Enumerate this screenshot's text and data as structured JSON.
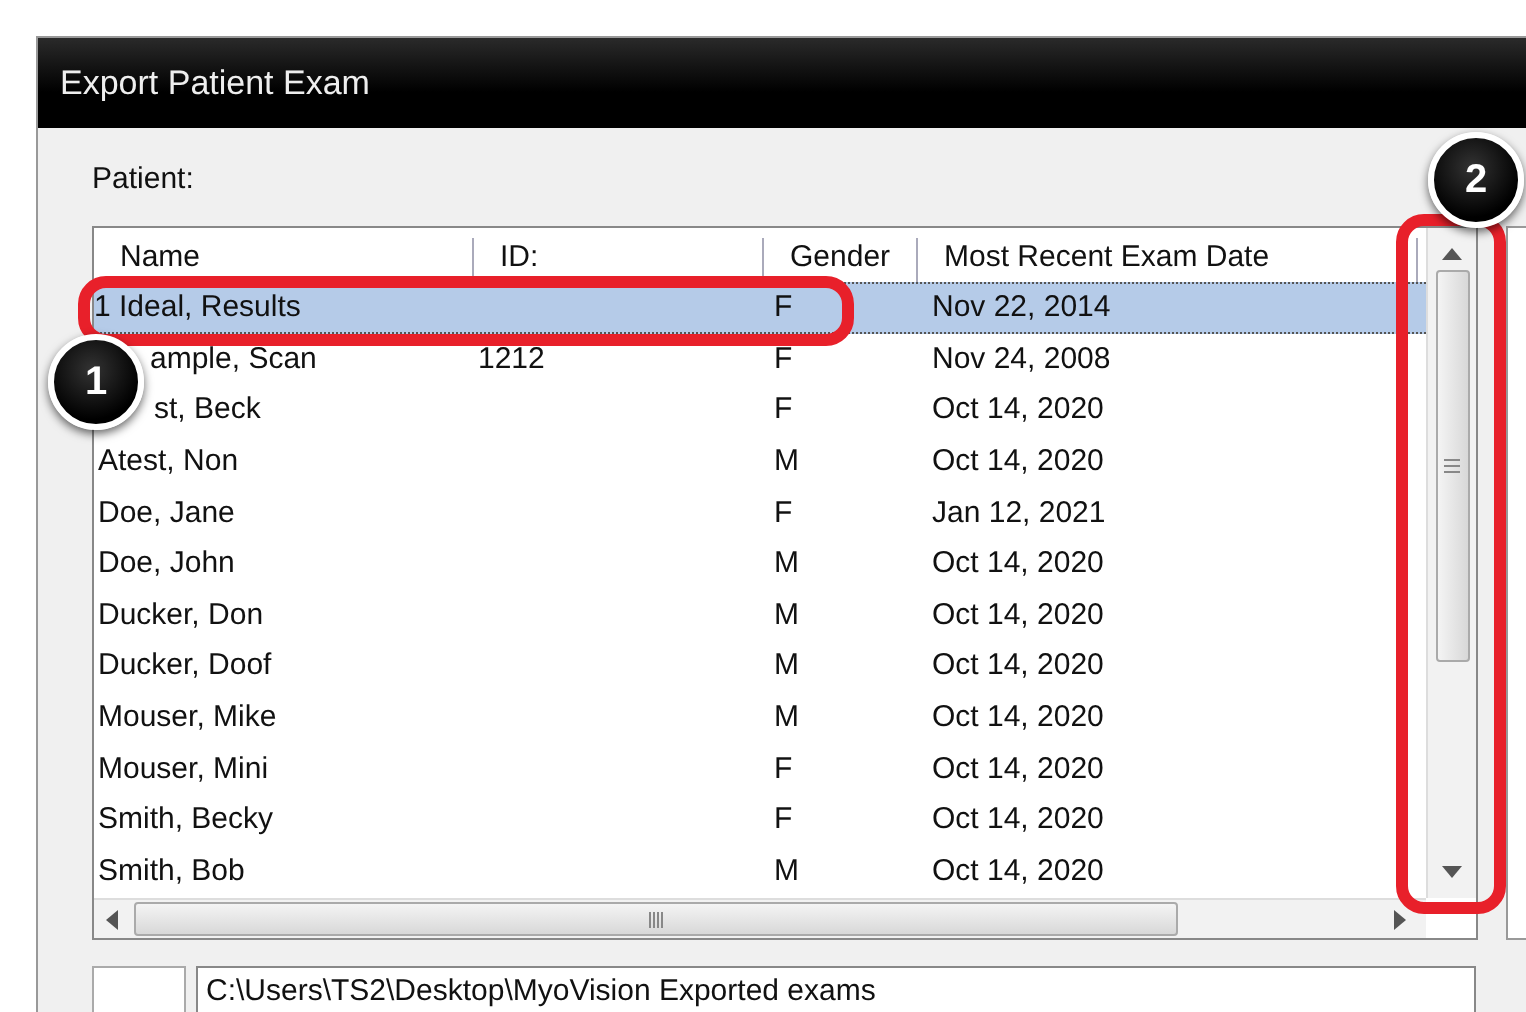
{
  "window": {
    "title": "Export Patient Exam"
  },
  "patient_label": "Patient:",
  "table": {
    "columns": [
      "Name",
      "ID:",
      "Gender",
      "Most Recent Exam Date"
    ],
    "rows": [
      {
        "cells": [
          "1 Ideal, Results",
          "",
          "F",
          "Nov 22, 2014"
        ],
        "selected": true
      },
      {
        "cells": [
          "ample, Scan",
          "1212",
          "F",
          "Nov 24, 2008"
        ],
        "selected": false
      },
      {
        "cells": [
          "st, Beck",
          "",
          "F",
          "Oct 14, 2020"
        ],
        "selected": false
      },
      {
        "cells": [
          "Atest, Non",
          "",
          "M",
          "Oct 14, 2020"
        ],
        "selected": false
      },
      {
        "cells": [
          "Doe, Jane",
          "",
          "F",
          "Jan 12, 2021"
        ],
        "selected": false
      },
      {
        "cells": [
          "Doe, John",
          "",
          "M",
          "Oct 14, 2020"
        ],
        "selected": false
      },
      {
        "cells": [
          "Ducker, Don",
          "",
          "M",
          "Oct 14, 2020"
        ],
        "selected": false
      },
      {
        "cells": [
          "Ducker, Doof",
          "",
          "M",
          "Oct 14, 2020"
        ],
        "selected": false
      },
      {
        "cells": [
          "Mouser, Mike",
          "",
          "M",
          "Oct 14, 2020"
        ],
        "selected": false
      },
      {
        "cells": [
          "Mouser, Mini",
          "",
          "F",
          "Oct 14, 2020"
        ],
        "selected": false
      },
      {
        "cells": [
          "Smith, Becky",
          "",
          "F",
          "Oct 14, 2020"
        ],
        "selected": false
      },
      {
        "cells": [
          "Smith, Bob",
          "",
          "M",
          "Oct 14, 2020"
        ],
        "selected": false
      }
    ]
  },
  "export_path": "C:\\Users\\TS2\\Desktop\\MyoVision Exported exams",
  "callouts": [
    {
      "number": "1"
    },
    {
      "number": "2"
    }
  ]
}
